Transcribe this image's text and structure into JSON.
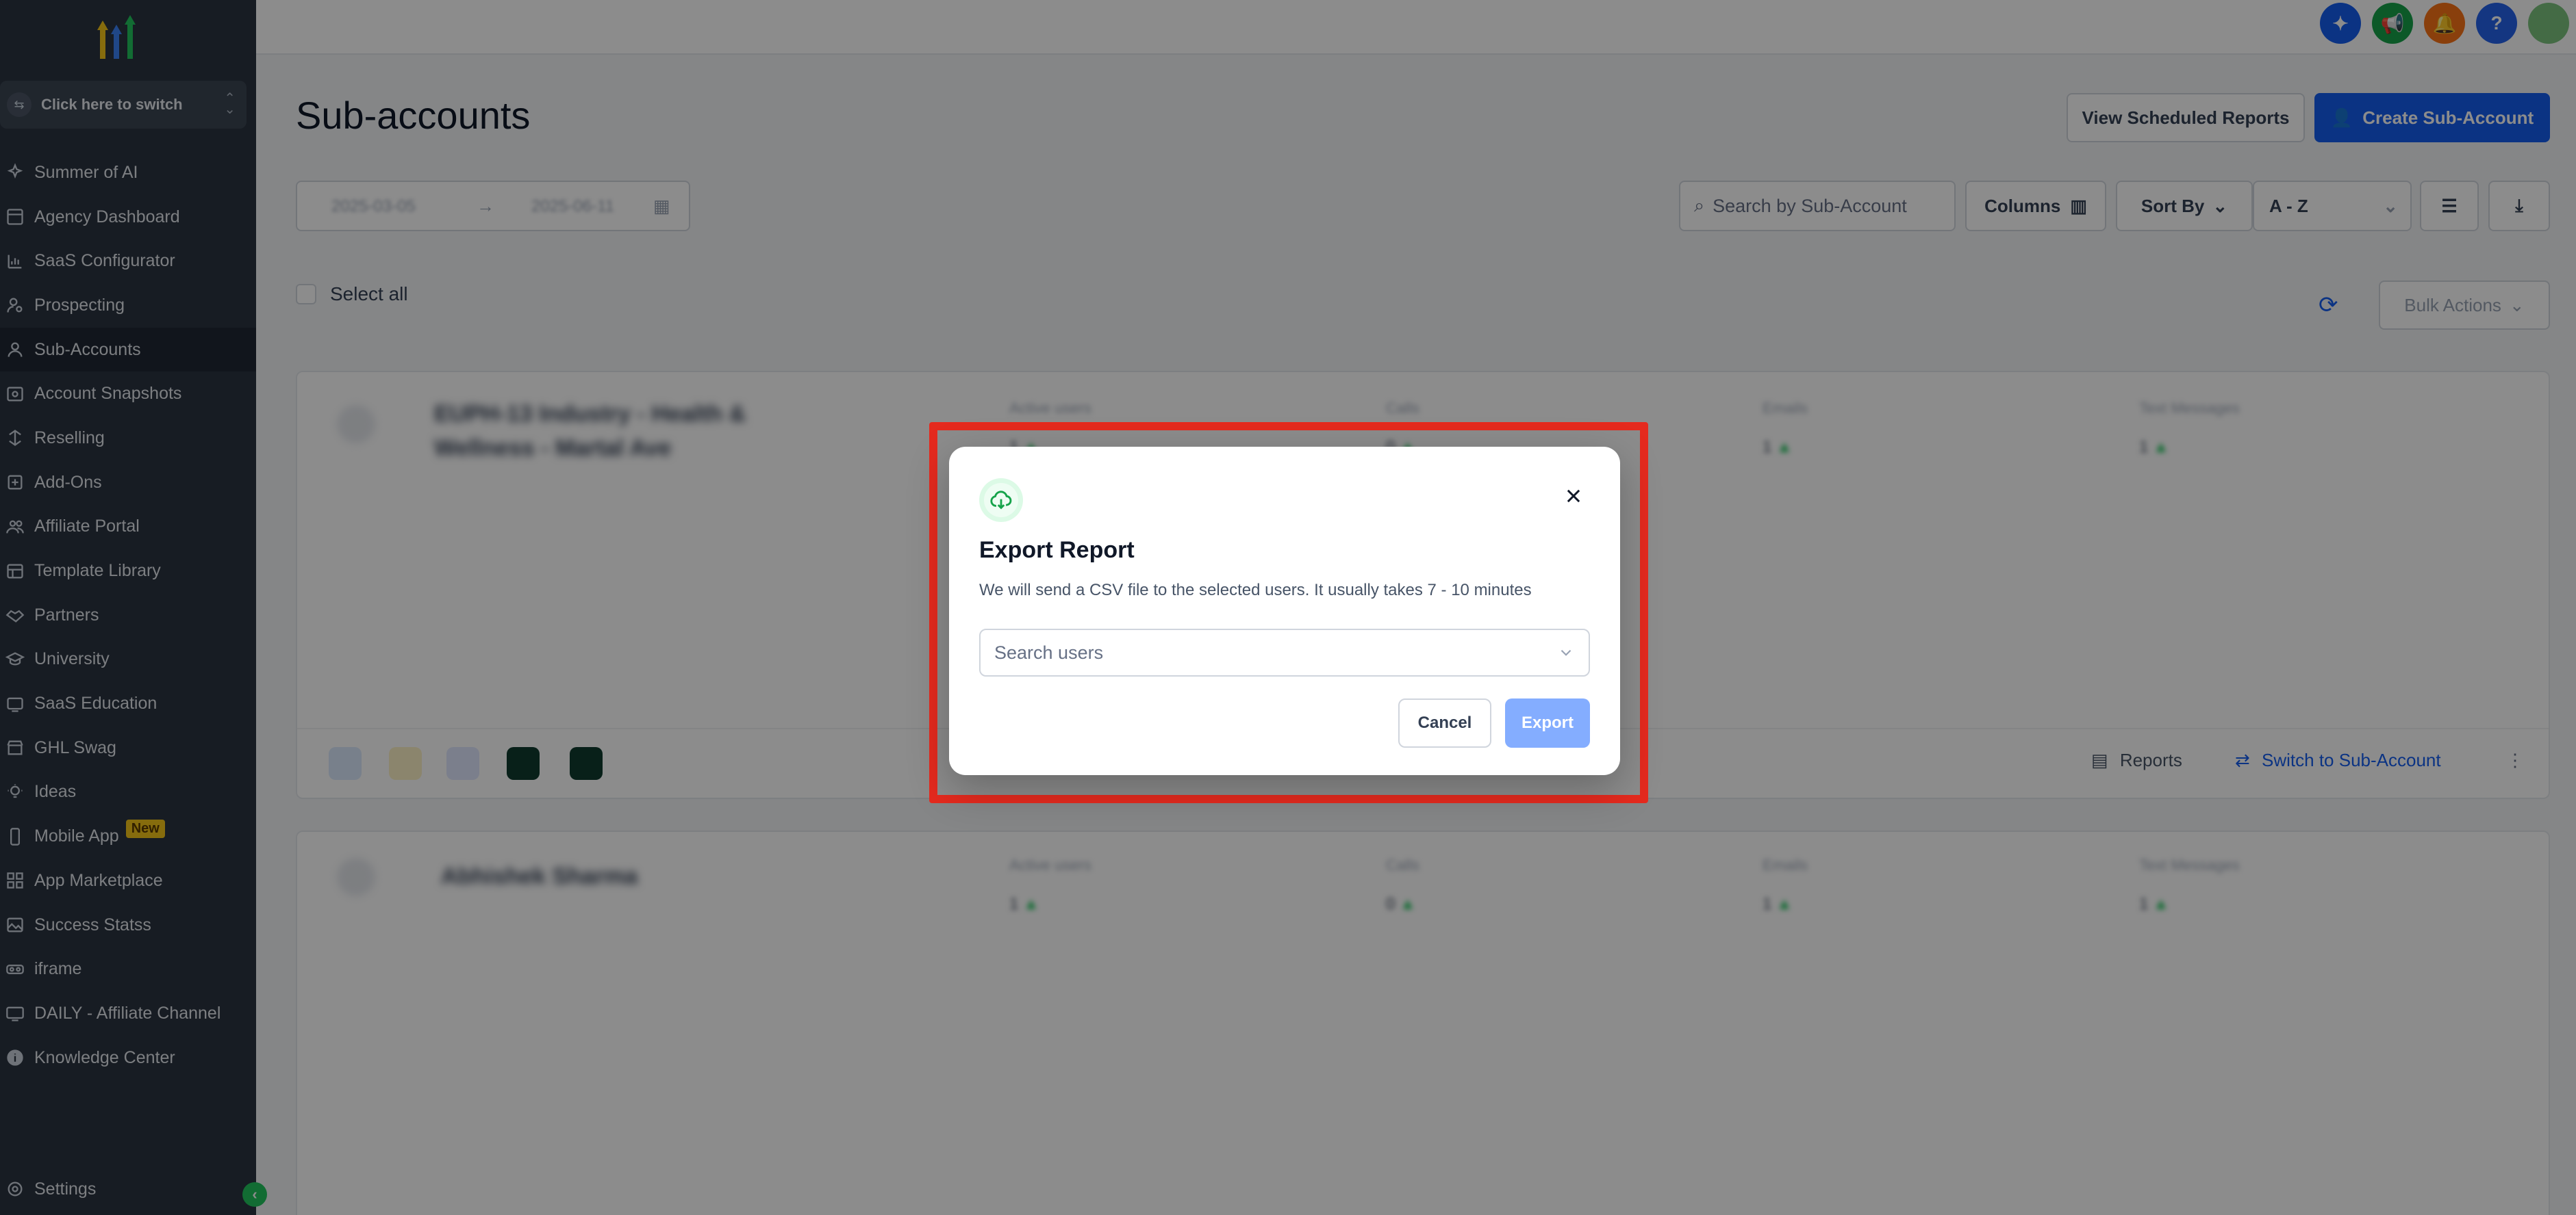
{
  "sidebar": {
    "switcher_label": "Click here to switch",
    "items": [
      {
        "label": "Summer of AI",
        "icon": "sparkles-icon"
      },
      {
        "label": "Agency Dashboard",
        "icon": "dashboard-icon"
      },
      {
        "label": "SaaS Configurator",
        "icon": "chart-icon"
      },
      {
        "label": "Prospecting",
        "icon": "user-search-icon"
      },
      {
        "label": "Sub-Accounts",
        "icon": "user-icon",
        "active": true
      },
      {
        "label": "Account Snapshots",
        "icon": "snapshot-icon"
      },
      {
        "label": "Reselling",
        "icon": "reselling-icon"
      },
      {
        "label": "Add-Ons",
        "icon": "addons-icon"
      },
      {
        "label": "Affiliate Portal",
        "icon": "users-icon"
      },
      {
        "label": "Template Library",
        "icon": "library-icon"
      },
      {
        "label": "Partners",
        "icon": "handshake-icon"
      },
      {
        "label": "University",
        "icon": "graduation-cap-icon"
      },
      {
        "label": "SaaS Education",
        "icon": "education-icon"
      },
      {
        "label": "GHL Swag",
        "icon": "store-icon"
      },
      {
        "label": "Ideas",
        "icon": "lightbulb-icon"
      },
      {
        "label": "Mobile App",
        "icon": "mobile-icon",
        "badge": "New"
      },
      {
        "label": "App Marketplace",
        "icon": "grid-icon"
      },
      {
        "label": "Success Statss",
        "icon": "image-icon"
      },
      {
        "label": "iframe",
        "icon": "vr-icon"
      },
      {
        "label": "DAILY - Affiliate Channel",
        "icon": "tv-icon"
      },
      {
        "label": "Knowledge Center",
        "icon": "info-icon"
      }
    ],
    "settings_label": "Settings"
  },
  "header": {
    "title": "Sub-accounts",
    "view_scheduled_label": "View Scheduled Reports",
    "create_label": "Create Sub-Account"
  },
  "toolbar": {
    "date_from": "2025-03-05",
    "date_to": "2025-06-11",
    "search_placeholder": "Search by Sub-Account",
    "columns_label": "Columns",
    "sort_by_label": "Sort By",
    "sort_value": "A - Z",
    "select_all_label": "Select all",
    "bulk_actions_label": "Bulk Actions"
  },
  "cards": [
    {
      "name": "EUPH-13 Industry - Health & Wellness - Martal Ave",
      "footer": {
        "reports_label": "Reports",
        "switch_label": "Switch to Sub-Account"
      }
    },
    {
      "name": "Abhishek Sharma"
    }
  ],
  "modal": {
    "title": "Export Report",
    "description": "We will send a CSV file to the selected users. It usually takes 7 - 10 minutes",
    "search_placeholder": "Search users",
    "cancel_label": "Cancel",
    "export_label": "Export"
  },
  "colors": {
    "sidebar_bg": "#2b3441",
    "primary": "#155eef",
    "highlight": "#e52a1e",
    "success": "#22c55e"
  }
}
